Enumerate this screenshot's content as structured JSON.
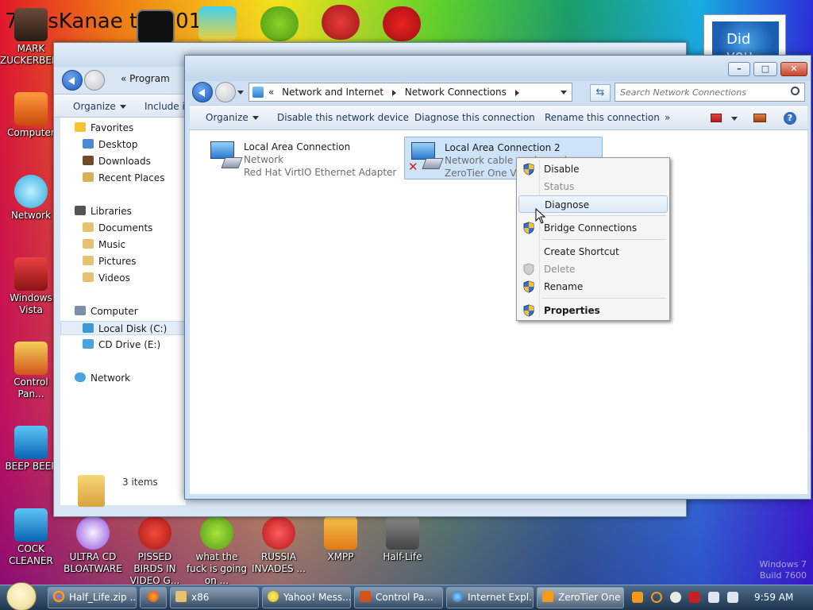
{
  "desktop": {
    "top_banner_text": "7 ossKanae tion 012",
    "icons_left": [
      {
        "label": "MARK ZUCKERBERG"
      },
      {
        "label": "Computer"
      },
      {
        "label": "Network"
      },
      {
        "label": "Windows Vista"
      },
      {
        "label": "Control Pan..."
      },
      {
        "label": "BEEP BEEP"
      },
      {
        "label": "COCK CLEANER"
      }
    ],
    "icons_bottom": [
      {
        "label": "ULTRA CD BLOATWARE"
      },
      {
        "label": "PISSED BIRDS IN VIDEO G..."
      },
      {
        "label": "what the fuck is going on ..."
      },
      {
        "label": "RUSSIA INVADES ..."
      },
      {
        "label": "XMPP"
      },
      {
        "label": "Half-Life"
      }
    ],
    "widget_text": "Did you",
    "watermark": [
      "Windows 7",
      "Build 7600"
    ]
  },
  "back_window": {
    "nav_path": "Program",
    "toolbar": {
      "organize": "Organize",
      "include": "Include in"
    },
    "tree": [
      {
        "label": "Favorites"
      },
      {
        "label": "Desktop"
      },
      {
        "label": "Downloads"
      },
      {
        "label": "Recent Places"
      },
      {
        "label": "Libraries"
      },
      {
        "label": "Documents"
      },
      {
        "label": "Music"
      },
      {
        "label": "Pictures"
      },
      {
        "label": "Videos"
      },
      {
        "label": "Computer"
      },
      {
        "label": "Local Disk (C:)"
      },
      {
        "label": "CD Drive (E:)"
      },
      {
        "label": "Network"
      }
    ],
    "status": "3 items"
  },
  "front_window": {
    "address": {
      "root": "«",
      "part1": "Network and Internet",
      "part2": "Network Connections"
    },
    "search_placeholder": "Search Network Connections",
    "toolbar": {
      "organize": "Organize",
      "disable": "Disable this network device",
      "diagnose": "Diagnose this connection",
      "rename": "Rename this connection",
      "more": "»"
    },
    "connections": [
      {
        "name": "Local Area Connection",
        "status": "Network",
        "adapter": "Red Hat VirtIO Ethernet Adapter"
      },
      {
        "name": "Local Area Connection 2",
        "status": "Network cable unplugged",
        "adapter": "ZeroTier One Vir..."
      }
    ]
  },
  "context_menu": {
    "items": {
      "disable": "Disable",
      "status": "Status",
      "diagnose": "Diagnose",
      "bridge": "Bridge Connections",
      "shortcut": "Create Shortcut",
      "delete": "Delete",
      "rename": "Rename",
      "properties": "Properties"
    }
  },
  "taskbar": {
    "tasks": [
      {
        "label": "Half_Life.zip ..."
      },
      {
        "label": ""
      },
      {
        "label": "x86"
      },
      {
        "label": "Yahoo! Mess..."
      },
      {
        "label": "Control Pa..."
      },
      {
        "label": "Internet Expl..."
      },
      {
        "label": "ZeroTier One"
      }
    ],
    "clock": "9:59 AM"
  },
  "colors": {
    "selection": "#cde3f8",
    "accent": "#1c59b8",
    "taskbar": "#20364f"
  }
}
